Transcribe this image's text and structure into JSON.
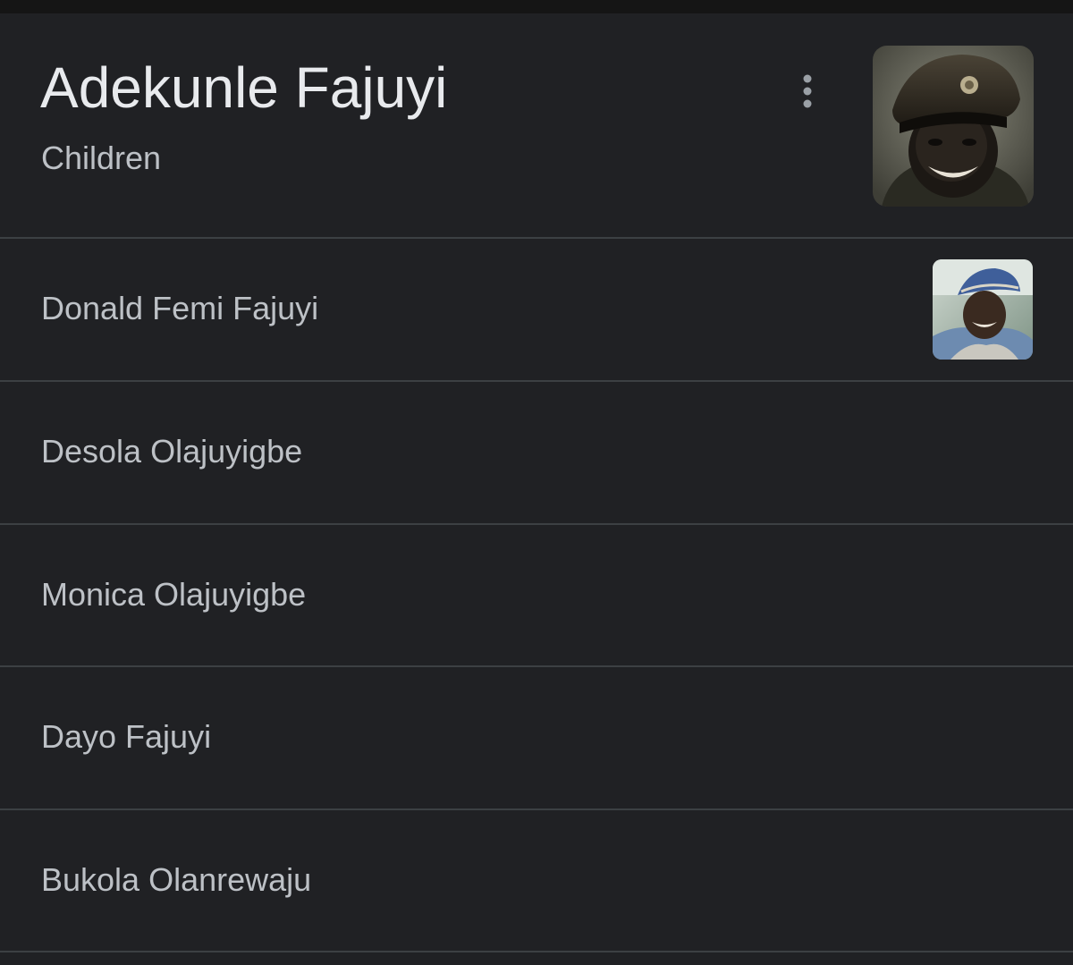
{
  "header": {
    "title": "Adekunle Fajuyi",
    "subtitle": "Children",
    "menu_icon": "more-vert-icon",
    "photo_icon": "portrait-photo"
  },
  "children": [
    {
      "name": "Donald Femi Fajuyi",
      "has_thumbnail": true
    },
    {
      "name": "Desola Olajuyigbe",
      "has_thumbnail": false
    },
    {
      "name": "Monica Olajuyigbe",
      "has_thumbnail": false
    },
    {
      "name": "Dayo Fajuyi",
      "has_thumbnail": false
    },
    {
      "name": "Bukola Olanrewaju",
      "has_thumbnail": false
    }
  ],
  "colors": {
    "background": "#202124",
    "title_text": "#e8eaed",
    "secondary_text": "#bdc1c6",
    "divider": "#3c4043"
  }
}
